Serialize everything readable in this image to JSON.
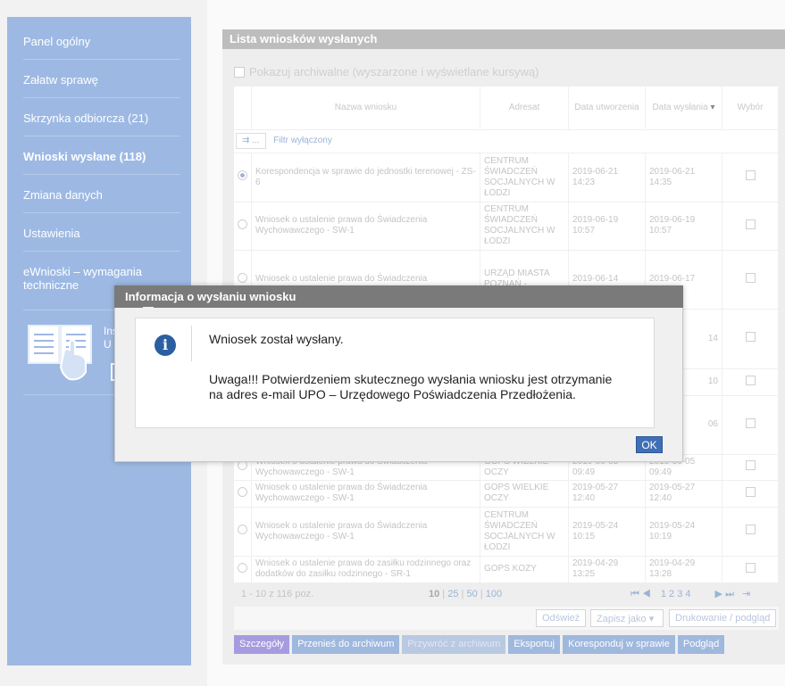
{
  "sidebar": {
    "items": [
      {
        "label": "Panel ogólny"
      },
      {
        "label": "Załatw sprawę"
      },
      {
        "label": "Skrzynka odbiorcza (21)"
      },
      {
        "label": "Wnioski wysłane (118)"
      },
      {
        "label": "Zmiana danych"
      },
      {
        "label": "Ustawienia"
      },
      {
        "label": "eWnioski – wymagania techniczne"
      }
    ],
    "instruction_text": "Ins\nU"
  },
  "list": {
    "title": "Lista wniosków wysłanych",
    "archive_checkbox_label": "Pokazuj archiwalne (wyszarzone i wyświetlane kursywą)",
    "columns": [
      "Nazwa wniosku",
      "Adresat",
      "Data utworzenia",
      "Data wysłania",
      "Wybór"
    ],
    "filter_button_label": "...",
    "filter_text": "Filtr wyłączony",
    "rows": [
      {
        "name": "Korespondencja w sprawie do jednostki terenowej - ZS-6",
        "addressee": "CENTRUM ŚWIADCZEŃ SOCJALNYCH W ŁODZI",
        "created": "2019-06-21 14:23",
        "sent": "2019-06-21 14:35",
        "selected": true
      },
      {
        "name": "Wniosek o ustalenie prawa do Świadczenia Wychowawczego - SW-1",
        "addressee": "CENTRUM ŚWIADCZEŃ SOCJALNYCH W ŁODZI",
        "created": "2019-06-19 10:57",
        "sent": "2019-06-19 10:57",
        "selected": false
      },
      {
        "name": "Wniosek o ustalenie prawa do Świadczenia",
        "addressee": "URZĄD MIASTA POZNAŃ -",
        "created": "2019-06-14",
        "sent": "2019-06-17",
        "selected": false
      },
      {
        "name": "",
        "addressee": "",
        "created": "",
        "sent": "14",
        "selected": false
      },
      {
        "name": "",
        "addressee": "",
        "created": "",
        "sent": "10",
        "selected": false
      },
      {
        "name": "",
        "addressee": "",
        "created": "",
        "sent": "06",
        "selected": false
      },
      {
        "name": "Wniosek o ustalenie prawa do Świadczenia Wychowawczego - SW-1",
        "addressee": "GOPS WIELKIE OCZY",
        "created": "2019-06-05 09:49",
        "sent": "2019-06-05 09:49",
        "selected": false
      },
      {
        "name": "Wniosek o ustalenie prawa do Świadczenia Wychowawczego - SW-1",
        "addressee": "GOPS WIELKIE OCZY",
        "created": "2019-05-27 12:40",
        "sent": "2019-05-27 12:40",
        "selected": false
      },
      {
        "name": "Wniosek o ustalenie prawa do Świadczenia Wychowawczego - SW-1",
        "addressee": "CENTRUM ŚWIADCZEŃ SOCJALNYCH W ŁODZI",
        "created": "2019-05-24 10:15",
        "sent": "2019-05-24 10:19",
        "selected": false
      },
      {
        "name": "Wniosek o ustalenie prawa do zasiłku rodzinnego oraz dodatków do zasiłku rodzinnego - SR-1",
        "addressee": "GOPS KOZY",
        "created": "2019-04-29 13:25",
        "sent": "2019-04-29 13:28",
        "selected": false
      }
    ],
    "pager": {
      "summary": "1 - 10 z 116 poz.",
      "sizes": [
        "10",
        "25",
        "50",
        "100"
      ],
      "pages": "1 2 3 4"
    },
    "toolbar": {
      "refresh": "Odśwież",
      "save_as": "Zapisz jako",
      "print": "Drukowanie / podgląd"
    },
    "actions": [
      "Szczegóły",
      "Przenieś do archiwum",
      "Przywróć z archiwum",
      "Eksportuj",
      "Koresponduj w sprawie",
      "Podgląd"
    ]
  },
  "modal": {
    "title": "Informacja o wysłaniu wniosku",
    "message_1": "Wniosek został wysłany.",
    "message_2": "Uwaga!!! Potwierdzeniem skutecznego wysłania wniosku jest otrzymanie na adres e-mail UPO – Urzędowego Poświadczenia Przedłożenia.",
    "ok_label": "OK"
  }
}
